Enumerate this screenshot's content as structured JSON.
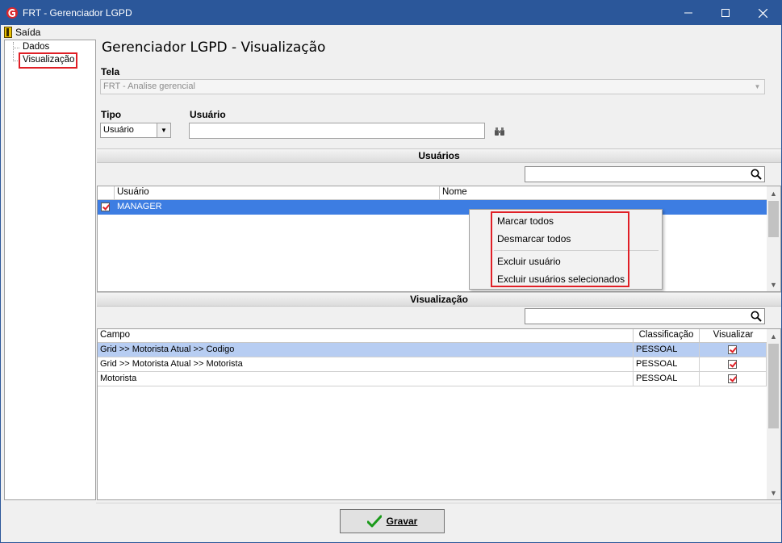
{
  "window": {
    "title": "FRT - Gerenciador LGPD",
    "controls": [
      "minimize",
      "maximize",
      "close"
    ]
  },
  "menu": {
    "exit_label": "Saída"
  },
  "tree": {
    "items": [
      {
        "label": "Dados"
      },
      {
        "label": "Visualização",
        "selected": true
      }
    ]
  },
  "page": {
    "title": "Gerenciador LGPD - Visualização"
  },
  "tela": {
    "label": "Tela",
    "value": "FRT - Analise gerencial"
  },
  "tipo": {
    "label": "Tipo",
    "value": "Usuário"
  },
  "usuario": {
    "label": "Usuário",
    "value": ""
  },
  "users_section": {
    "title": "Usuários",
    "search_value": "",
    "columns": [
      "Usuário",
      "Nome"
    ],
    "rows": [
      {
        "checked": true,
        "usuario": "MANAGER",
        "nome": ""
      }
    ]
  },
  "context_menu": {
    "items": [
      "Marcar todos",
      "Desmarcar todos",
      "Excluir usuário",
      "Excluir usuários selecionados"
    ]
  },
  "view_section": {
    "title": "Visualização",
    "search_value": "",
    "columns": [
      "Campo",
      "Classificação",
      "Visualizar"
    ],
    "rows": [
      {
        "campo": "Grid >> Motorista Atual >> Codigo",
        "classificacao": "PESSOAL",
        "visualizar": true
      },
      {
        "campo": "Grid >> Motorista Atual >> Motorista",
        "classificacao": "PESSOAL",
        "visualizar": true
      },
      {
        "campo": "Motorista",
        "classificacao": "PESSOAL",
        "visualizar": true
      }
    ]
  },
  "save_button": {
    "label": "Gravar",
    "icon": "checkmark-icon"
  },
  "colors": {
    "titlebar": "#2b579a",
    "selection": "#3d7de2",
    "selection_light": "#b7cdf2",
    "highlight": "#e01f26"
  }
}
